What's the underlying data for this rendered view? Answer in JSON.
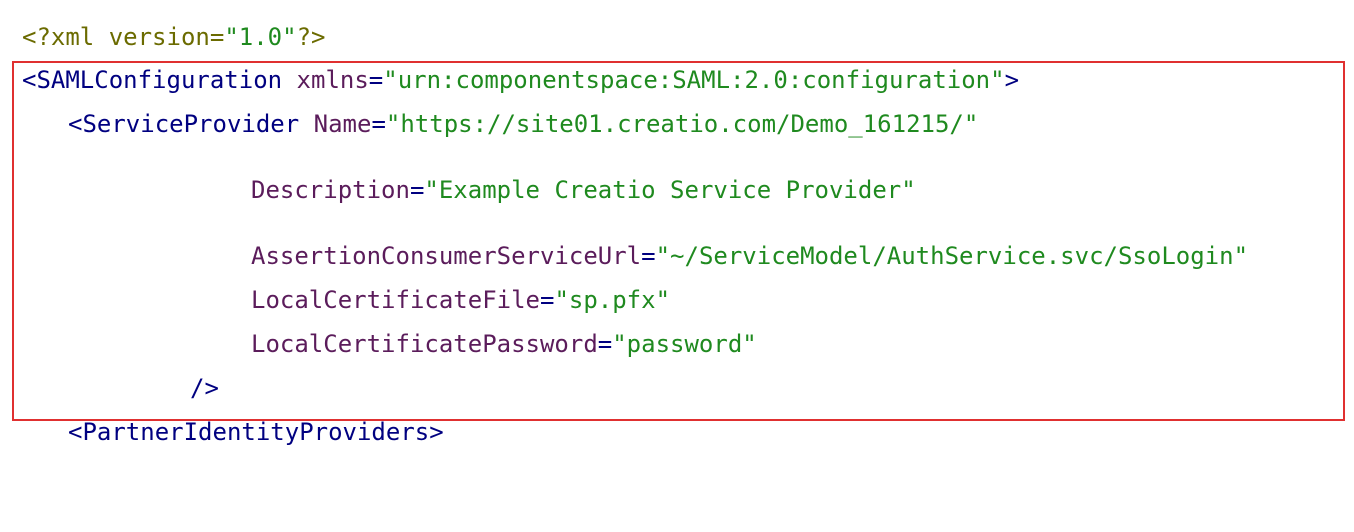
{
  "xml_decl": {
    "open": "<?xml",
    "attr": "version",
    "eq": "=",
    "value": "\"1.0\"",
    "close": "?>"
  },
  "saml_config": {
    "open": "<SAMLConfiguration",
    "attr": "xmlns",
    "eq": "=",
    "value": "\"urn:componentspace:SAML:2.0:configuration\"",
    "close": ">"
  },
  "service_provider": {
    "open": "<ServiceProvider",
    "name_attr": "Name",
    "name_value": "\"https://site01.creatio.com/Demo_161215/\"",
    "description_attr": "Description",
    "description_value": "\"Example Creatio Service Provider\"",
    "acs_attr": "AssertionConsumerServiceUrl",
    "acs_value": "\"~/ServiceModel/AuthService.svc/SsoLogin\"",
    "cert_file_attr": "LocalCertificateFile",
    "cert_file_value": "\"sp.pfx\"",
    "cert_pass_attr": "LocalCertificatePassword",
    "cert_pass_value": "\"password\"",
    "self_close": "/>"
  },
  "partner_idp": {
    "open": "<PartnerIdentityProviders",
    "close": ">"
  },
  "eq": "=",
  "colors": {
    "highlight_border": "#e03030",
    "tag": "#000080",
    "attr": "#5b1c5b",
    "value": "#1f8a1f"
  }
}
